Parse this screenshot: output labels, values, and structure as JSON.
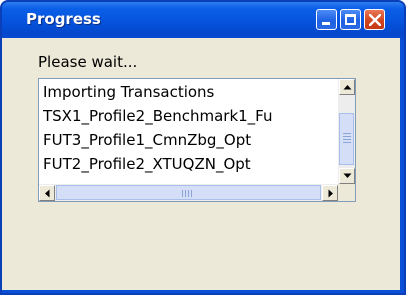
{
  "window": {
    "title": "Progress"
  },
  "titlebar_buttons": {
    "minimize_icon": "minimize-icon",
    "maximize_icon": "maximize-icon",
    "close_icon": "close-icon"
  },
  "content": {
    "message": "Please wait...",
    "log_lines": [
      "Importing Transactions",
      "TSX1_Profile2_Benchmark1_Fu",
      "FUT3_Profile1_CmnZbg_Opt",
      "FUT2_Profile2_XTUQZN_Opt"
    ]
  },
  "scrollbars": {
    "up_icon": "arrow-up-icon",
    "down_icon": "arrow-down-icon",
    "left_icon": "arrow-left-icon",
    "right_icon": "arrow-right-icon"
  },
  "colors": {
    "titlebar": "#0654de",
    "client_background": "#ece9d8",
    "close_button": "#d1451e"
  }
}
